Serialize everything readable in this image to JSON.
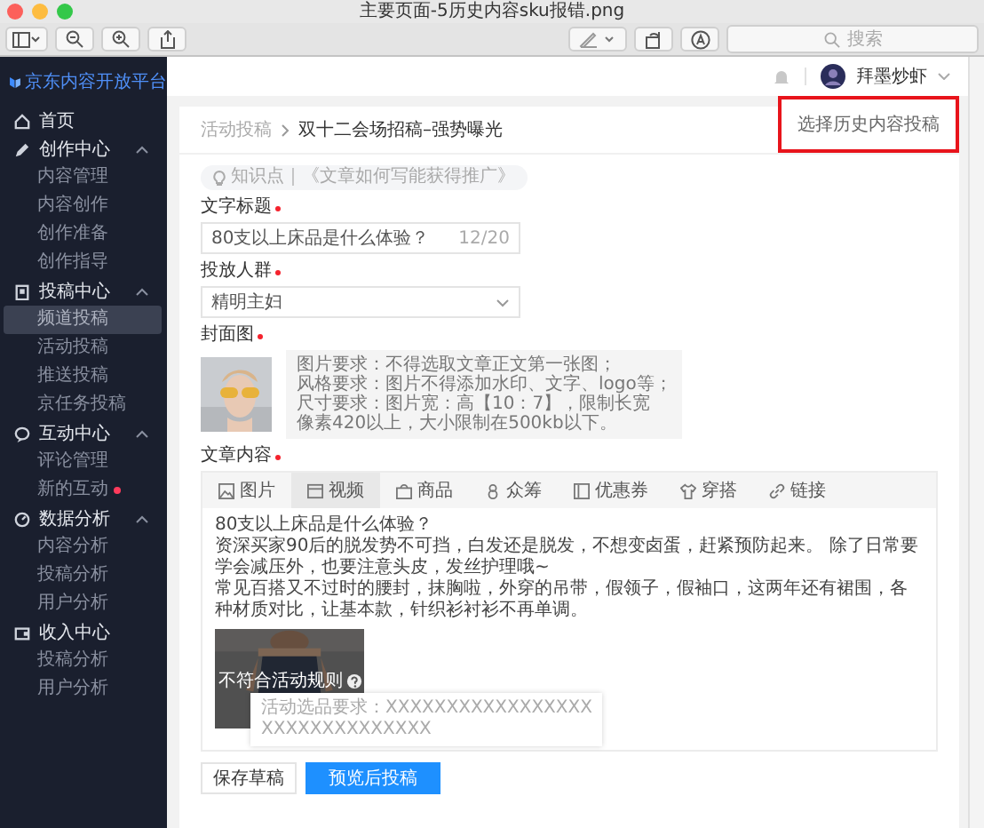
{
  "window": {
    "title": "主要页面-5历史内容sku报错.png",
    "search": {
      "placeholder": "搜索"
    }
  },
  "header": {
    "user_name": "拜墨炒虾"
  },
  "sidebar": {
    "logo": "京东内容开放平台",
    "groups": [
      {
        "label": "首页"
      },
      {
        "label": "创作中心",
        "expanded": true,
        "children": [
          {
            "label": "内容管理",
            "selected": false,
            "badge": false
          },
          {
            "label": "内容创作",
            "selected": false,
            "badge": false
          },
          {
            "label": "创作准备",
            "selected": false,
            "badge": false
          },
          {
            "label": "创作指导",
            "selected": false,
            "badge": false
          }
        ]
      },
      {
        "label": "投稿中心",
        "expanded": true,
        "children": [
          {
            "label": "频道投稿",
            "selected": true,
            "badge": false
          },
          {
            "label": "活动投稿",
            "selected": false,
            "badge": false
          },
          {
            "label": "推送投稿",
            "selected": false,
            "badge": false
          },
          {
            "label": "京任务投稿",
            "selected": false,
            "badge": false
          }
        ]
      },
      {
        "label": "互动中心",
        "expanded": true,
        "children": [
          {
            "label": "评论管理",
            "selected": false,
            "badge": false
          },
          {
            "label": "新的互动",
            "selected": false,
            "badge": true
          }
        ]
      },
      {
        "label": "数据分析",
        "expanded": true,
        "children": [
          {
            "label": "内容分析",
            "selected": false,
            "badge": false
          },
          {
            "label": "投稿分析",
            "selected": false,
            "badge": false
          },
          {
            "label": "用户分析",
            "selected": false,
            "badge": false
          }
        ]
      },
      {
        "label": "收入中心",
        "children": [
          {
            "label": "投稿分析",
            "selected": false,
            "badge": false
          },
          {
            "label": "用户分析",
            "selected": false,
            "badge": false
          }
        ]
      }
    ]
  },
  "breadcrumb": [
    "活动投稿",
    "双十二会场招稿–强势曝光"
  ],
  "history_link": "选择历史内容投稿",
  "tip": "知识点｜《文章如何写能获得推广》",
  "form": {
    "title": {
      "label": "文字标题",
      "required": true,
      "value": "80支以上床品是什么体验？",
      "counter": "12/20"
    },
    "audience": {
      "label": "投放人群",
      "required": true,
      "value": "精明主妇"
    },
    "cover": {
      "label": "封面图",
      "required": true,
      "hints": [
        "图片要求：不得选取文章正文第一张图；",
        "风格要求：图片不得添加水印、文字、logo等；",
        "尺寸要求：图片宽：高【10：7】，限制长宽",
        "像素420以上，大小限制在500kb以下。"
      ]
    },
    "content": {
      "label": "文章内容",
      "required": true,
      "tools": [
        {
          "label": "图片",
          "selected": false
        },
        {
          "label": "视频",
          "selected": true
        },
        {
          "label": "商品",
          "selected": false
        },
        {
          "label": "众筹",
          "selected": false
        },
        {
          "label": "优惠券",
          "selected": false
        },
        {
          "label": "穿搭",
          "selected": false
        },
        {
          "label": "链接",
          "selected": false
        }
      ],
      "paragraphs": [
        "80支以上床品是什么体验？",
        "资深买家90后的脱发势不可挡，白发还是脱发，不想变卤蛋，赶紧预防起来。 除了日常要学会减压外，也要注意头皮，发丝护理哦~",
        "常见百搭又不过时的腰封，抹胸啦，外穿的吊带，假领子，假袖口，这两年还有裙围，各种材质对比，让基本款，针织衫衬衫不再单调。"
      ],
      "image_warning": "不符合活动规则",
      "tooltip": [
        "活动选品要求：XXXXXXXXXXXXXXXXX",
        "XXXXXXXXXXXXXX"
      ]
    }
  },
  "buttons": [
    {
      "label": "保存草稿",
      "kind": "secondary"
    },
    {
      "label": "预览后投稿",
      "kind": "primary"
    }
  ]
}
